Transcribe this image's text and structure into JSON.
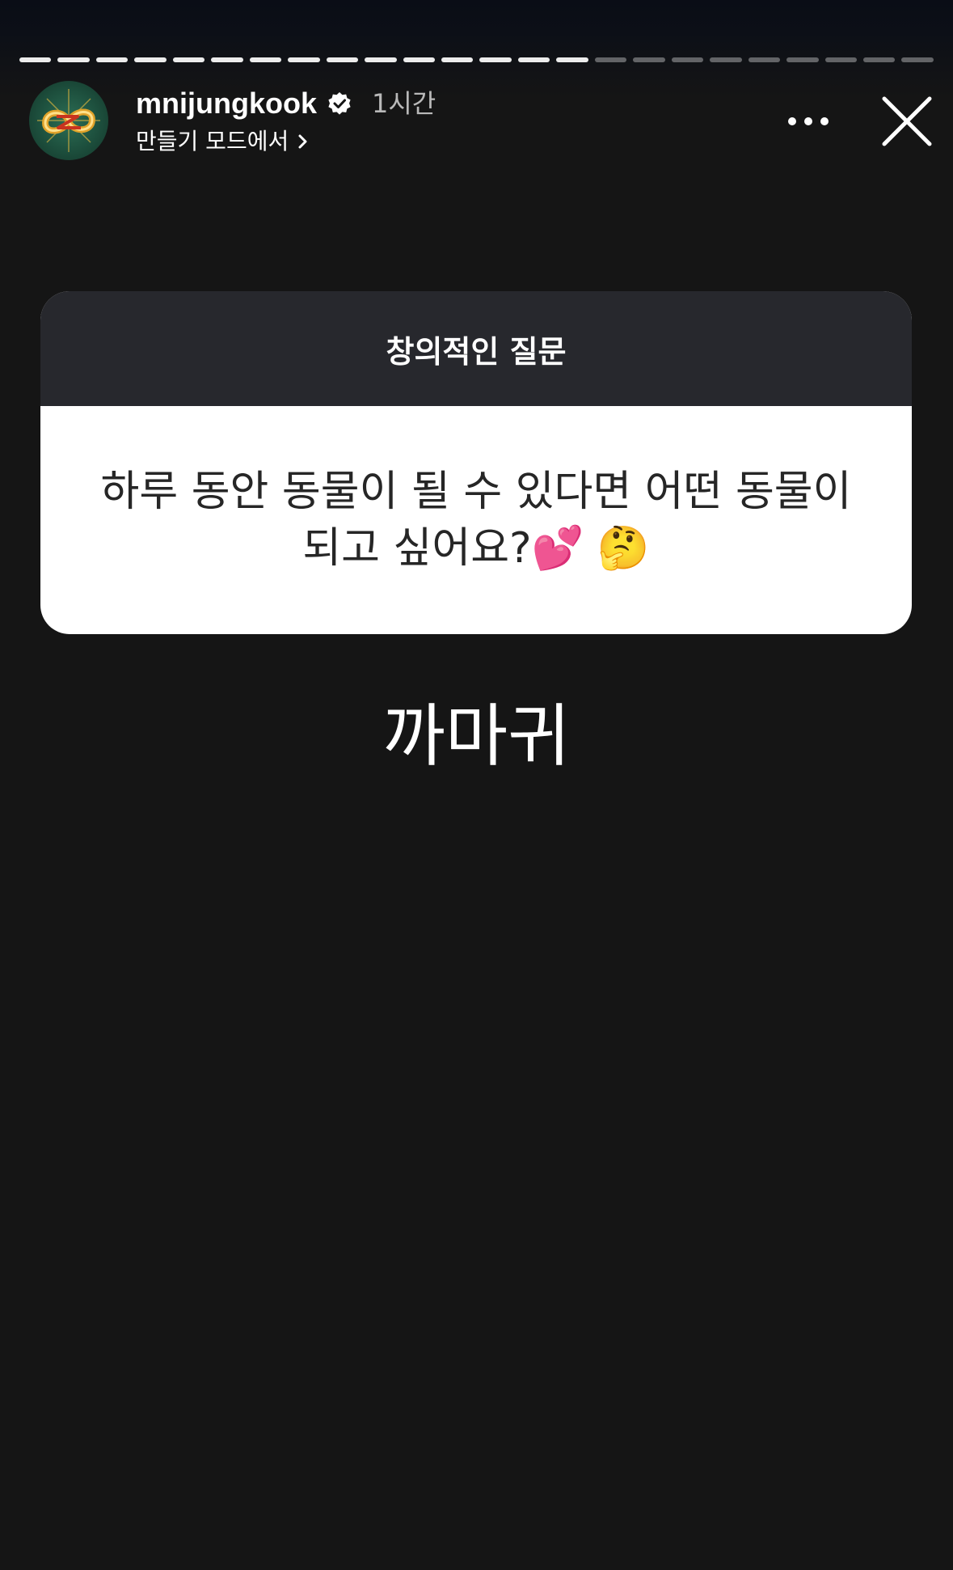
{
  "story": {
    "segments_total": 24,
    "segments_done": 15
  },
  "header": {
    "username": "mnijungkook",
    "time": "1시간",
    "subtitle": "만들기 모드에서"
  },
  "question_card": {
    "title": "창의적인 질문",
    "question": "하루 동안 동물이 될 수 있다면 어떤 동물이 되고 싶어요?💕 🤔"
  },
  "answer": "까마귀"
}
